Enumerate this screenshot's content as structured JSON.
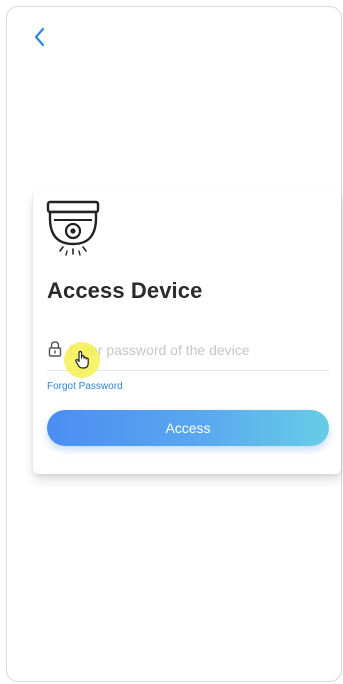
{
  "header": {
    "back_icon": "chevron-left-icon"
  },
  "card": {
    "device_icon": "dome-camera-icon",
    "title": "Access Device",
    "password": {
      "icon": "lock-icon",
      "value": "",
      "placeholder": "Enter password of the device"
    },
    "forgot_label": "Forgot Password",
    "access_label": "Access"
  },
  "overlay": {
    "touch_icon": "hand-pointer-icon"
  },
  "colors": {
    "accent": "#2f86d6",
    "button_gradient_start": "#4b8df2",
    "button_gradient_end": "#66cde6",
    "touch_highlight": "#f4f050"
  }
}
